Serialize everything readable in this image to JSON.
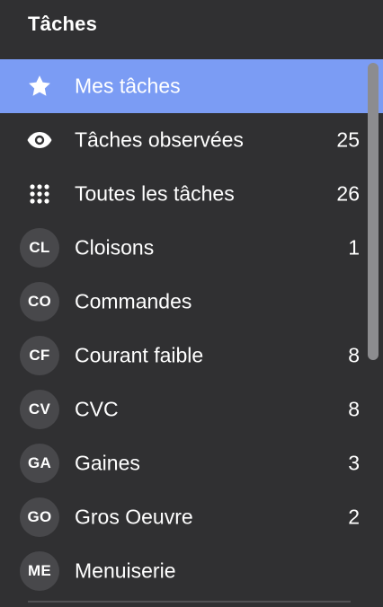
{
  "header": {
    "title": "Tâches"
  },
  "colors": {
    "background": "#303032",
    "active_bg": "#7b9cf4",
    "badge_bg": "#48484b",
    "scrollbar": "#8c8c8f"
  },
  "items": [
    {
      "icon": "star-icon",
      "label": "Mes tâches",
      "count": "",
      "active": true
    },
    {
      "icon": "eye-icon",
      "label": "Tâches observées",
      "count": "25"
    },
    {
      "icon": "grid-dots-icon",
      "label": "Toutes les tâches",
      "count": "26"
    },
    {
      "badge": "CL",
      "label": "Cloisons",
      "count": "1"
    },
    {
      "badge": "CO",
      "label": "Commandes",
      "count": ""
    },
    {
      "badge": "CF",
      "label": "Courant faible",
      "count": "8"
    },
    {
      "badge": "CV",
      "label": "CVC",
      "count": "8"
    },
    {
      "badge": "GA",
      "label": "Gaines",
      "count": "3"
    },
    {
      "badge": "GO",
      "label": "Gros Oeuvre",
      "count": "2"
    },
    {
      "badge": "ME",
      "label": "Menuiserie",
      "count": ""
    }
  ]
}
